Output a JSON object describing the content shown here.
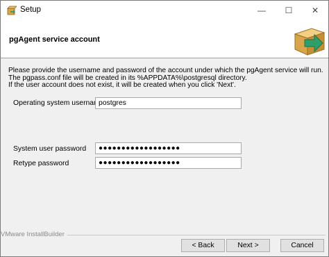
{
  "window": {
    "title": "Setup",
    "minimize_glyph": "—",
    "maximize_glyph": "☐",
    "close_glyph": "✕"
  },
  "header": {
    "title": "pgAgent service account",
    "icon": "installer-box-arrow-icon"
  },
  "description": {
    "line1": "Please provide the username and password of the account under which the pgAgent service will run.",
    "line2": "The pgpass.conf file will be created in its %APPDATA%\\postgresql directory.",
    "line3": "If the user account does not exist, it will be created when you click 'Next'."
  },
  "form": {
    "os_username_label": "Operating system username",
    "os_username_value": "postgres",
    "system_password_label": "System user password",
    "system_password_value": "●●●●●●●●●●●●●●●●●●",
    "retype_password_label": "Retype password",
    "retype_password_value": "●●●●●●●●●●●●●●●●●●"
  },
  "footer": {
    "brand": "VMware InstallBuilder",
    "back_label": "< Back",
    "next_label": "Next >",
    "cancel_label": "Cancel"
  },
  "colors": {
    "icon_box": "#d9a54a",
    "icon_arrow": "#2e9e6a"
  }
}
